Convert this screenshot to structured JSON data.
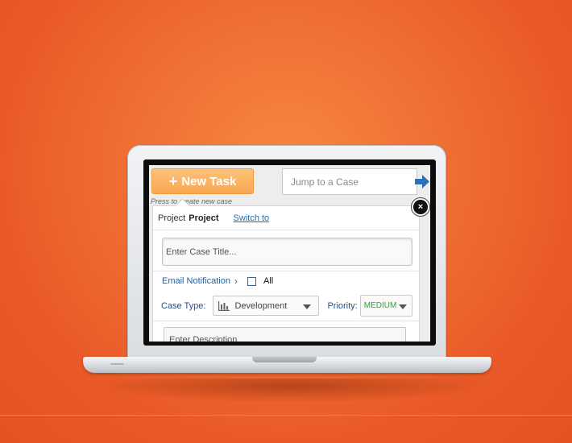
{
  "toolbar": {
    "new_task_label": "New Task",
    "new_task_icon": "plus-icon",
    "press_hint": "Press  to create new case",
    "jump_placeholder": "Jump to a Case",
    "jump_icon": "arrow-right-icon"
  },
  "panel": {
    "project_prefix": "Project",
    "project_name": "Project",
    "switch_label": "Switch to",
    "close_icon": "close-icon",
    "close_glyph": "×",
    "case_title_placeholder": "Enter Case Title...",
    "email_label": "Email Notification",
    "email_chevron": "›",
    "all_label": "All",
    "all_checked": false,
    "case_type_label": "Case Type:",
    "case_type_value": "Development",
    "priority_label": "Priority:",
    "priority_value": "MEDIUM",
    "description_placeholder": "Enter Description"
  },
  "colors": {
    "background": "#ea5a28",
    "new_task_button": "#f7a852",
    "link": "#1f6fb0",
    "priority_medium": "#2e9e34",
    "jump_arrow": "#2d6fb8"
  }
}
